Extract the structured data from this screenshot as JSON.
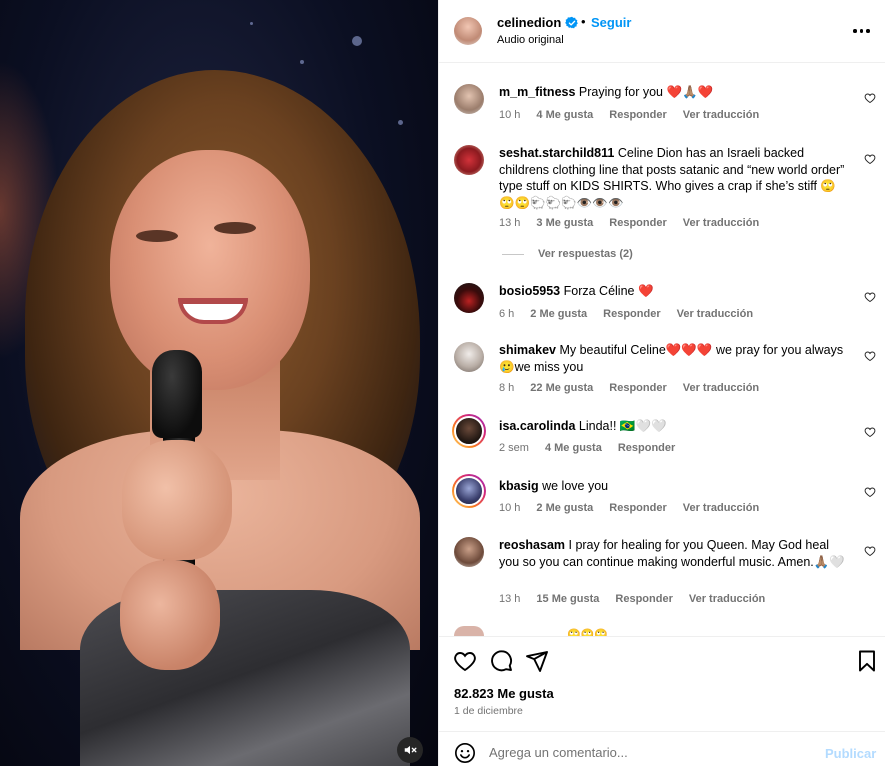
{
  "post": {
    "username": "celinedion",
    "separator": "•",
    "follow_label": "Seguir",
    "audio_label": "Audio original",
    "likes_text": "82.823 Me gusta",
    "date": "1 de diciembre",
    "comment_placeholder": "Agrega un comentario...",
    "publish_label": "Publicar"
  },
  "comments": [
    {
      "username": "m_m_fitness",
      "text": "Praying for you ❤️🙏🏽❤️",
      "time": "10 h",
      "likes": "4 Me gusta",
      "reply": "Responder",
      "translate": "Ver traducción"
    },
    {
      "username": "seshat.starchild811",
      "text": "Celine Dion has an Israeli backed childrens clothing line that posts satanic and “new world order” type stuff on KIDS SHIRTS. Who gives a crap if she’s stiff 🙄🙄🙄🐑🐑🐑👁️👁️👁️",
      "time": "13 h",
      "likes": "3 Me gusta",
      "reply": "Responder",
      "translate": "Ver traducción",
      "replies": "Ver respuestas (2)"
    },
    {
      "username": "bosio5953",
      "text": "Forza Céline ❤️",
      "time": "6 h",
      "likes": "2 Me gusta",
      "reply": "Responder",
      "translate": "Ver traducción"
    },
    {
      "username": "shimakev",
      "text": "My beautiful Celine❤️❤️❤️ we pray for you always 🥲we miss you",
      "time": "8 h",
      "likes": "22 Me gusta",
      "reply": "Responder",
      "translate": "Ver traducción"
    },
    {
      "username": "isa.carolinda",
      "text": "Linda!! 🇧🇷🤍🤍",
      "time": "2 sem",
      "likes": "4 Me gusta",
      "reply": "Responder"
    },
    {
      "username": "kbasig",
      "text": "we love you",
      "time": "10 h",
      "likes": "2 Me gusta",
      "reply": "Responder",
      "translate": "Ver traducción"
    },
    {
      "username": "reoshasam",
      "text": "I pray for healing for you Queen. May God heal you so you can continue making wonderful music. Amen.🙏🏽🤍",
      "time": "13 h",
      "likes": "15 Me gusta",
      "reply": "Responder",
      "translate": "Ver traducción"
    }
  ],
  "partial_comment_emoji": "🙄🙄🙄",
  "icons": [
    "verified-badge-icon",
    "more-options-icon",
    "heart-icon",
    "comment-icon",
    "share-icon",
    "bookmark-icon",
    "emoji-icon",
    "mute-icon"
  ],
  "colors": {
    "accent": "#0095f6",
    "like_red": "#ed4956",
    "muted_text": "#737373",
    "publish_disabled": "#b3dbff"
  }
}
